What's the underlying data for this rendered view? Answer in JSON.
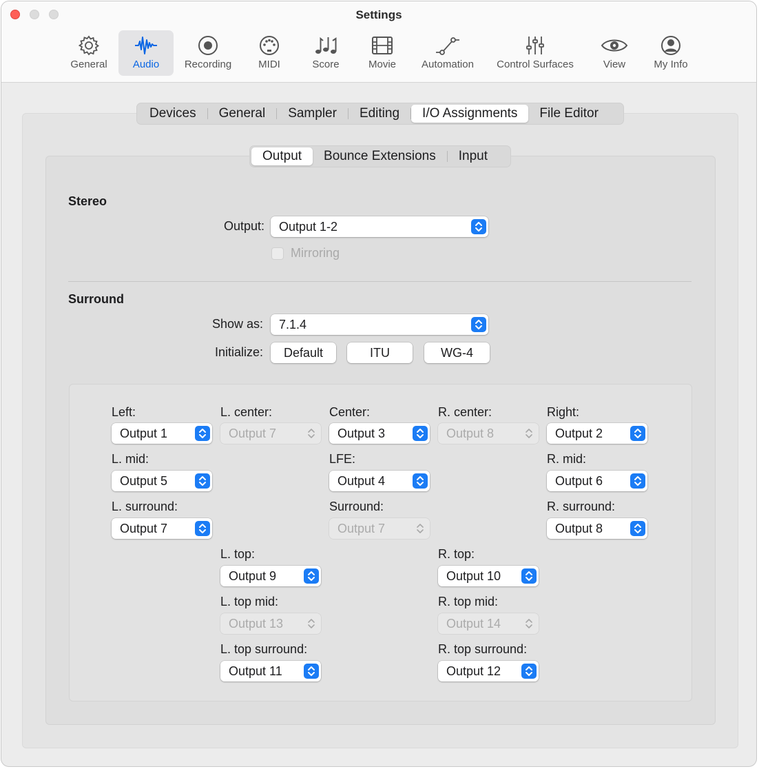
{
  "window": {
    "title": "Settings"
  },
  "toolbar": [
    {
      "label": "General",
      "icon": "gear-icon"
    },
    {
      "label": "Audio",
      "icon": "waveform-icon"
    },
    {
      "label": "Recording",
      "icon": "record-icon"
    },
    {
      "label": "MIDI",
      "icon": "midi-port-icon"
    },
    {
      "label": "Score",
      "icon": "music-notes-icon"
    },
    {
      "label": "Movie",
      "icon": "film-icon"
    },
    {
      "label": "Automation",
      "icon": "automation-curve-icon"
    },
    {
      "label": "Control Surfaces",
      "icon": "sliders-icon"
    },
    {
      "label": "View",
      "icon": "eye-icon"
    },
    {
      "label": "My Info",
      "icon": "person-circle-icon"
    }
  ],
  "toolbar_selected": "Audio",
  "tabs": [
    "Devices",
    "General",
    "Sampler",
    "Editing",
    "I/O Assignments",
    "File Editor"
  ],
  "tabs_selected": "I/O Assignments",
  "subtabs": [
    "Output",
    "Bounce Extensions",
    "Input"
  ],
  "subtabs_selected": "Output",
  "stereo": {
    "title": "Stereo",
    "output_label": "Output:",
    "output_value": "Output 1-2",
    "mirroring_label": "Mirroring",
    "mirroring_checked": false,
    "mirroring_enabled": false
  },
  "surround": {
    "title": "Surround",
    "show_as_label": "Show as:",
    "show_as_value": "7.1.4",
    "initialize_label": "Initialize:",
    "init_buttons": [
      "Default",
      "ITU",
      "WG-4"
    ]
  },
  "channels": {
    "left": {
      "label": "Left:",
      "value": "Output 1",
      "enabled": true
    },
    "l_center": {
      "label": "L. center:",
      "value": "Output 7",
      "enabled": false
    },
    "center": {
      "label": "Center:",
      "value": "Output 3",
      "enabled": true
    },
    "r_center": {
      "label": "R. center:",
      "value": "Output 8",
      "enabled": false
    },
    "right": {
      "label": "Right:",
      "value": "Output 2",
      "enabled": true
    },
    "l_mid": {
      "label": "L. mid:",
      "value": "Output 5",
      "enabled": true
    },
    "lfe": {
      "label": "LFE:",
      "value": "Output 4",
      "enabled": true
    },
    "r_mid": {
      "label": "R. mid:",
      "value": "Output 6",
      "enabled": true
    },
    "l_surround": {
      "label": "L. surround:",
      "value": "Output 7",
      "enabled": true
    },
    "surround": {
      "label": "Surround:",
      "value": "Output 7",
      "enabled": false
    },
    "r_surround": {
      "label": "R. surround:",
      "value": "Output 8",
      "enabled": true
    },
    "l_top": {
      "label": "L. top:",
      "value": "Output 9",
      "enabled": true
    },
    "r_top": {
      "label": "R. top:",
      "value": "Output 10",
      "enabled": true
    },
    "l_top_mid": {
      "label": "L. top mid:",
      "value": "Output 13",
      "enabled": false
    },
    "r_top_mid": {
      "label": "R. top mid:",
      "value": "Output 14",
      "enabled": false
    },
    "l_top_surround": {
      "label": "L. top surround:",
      "value": "Output 11",
      "enabled": true
    },
    "r_top_surround": {
      "label": "R. top surround:",
      "value": "Output 12",
      "enabled": true
    }
  },
  "colors": {
    "accent": "#1b7cf5",
    "close": "#fe5f57",
    "selected_toolbar_text": "#0a66e4"
  }
}
